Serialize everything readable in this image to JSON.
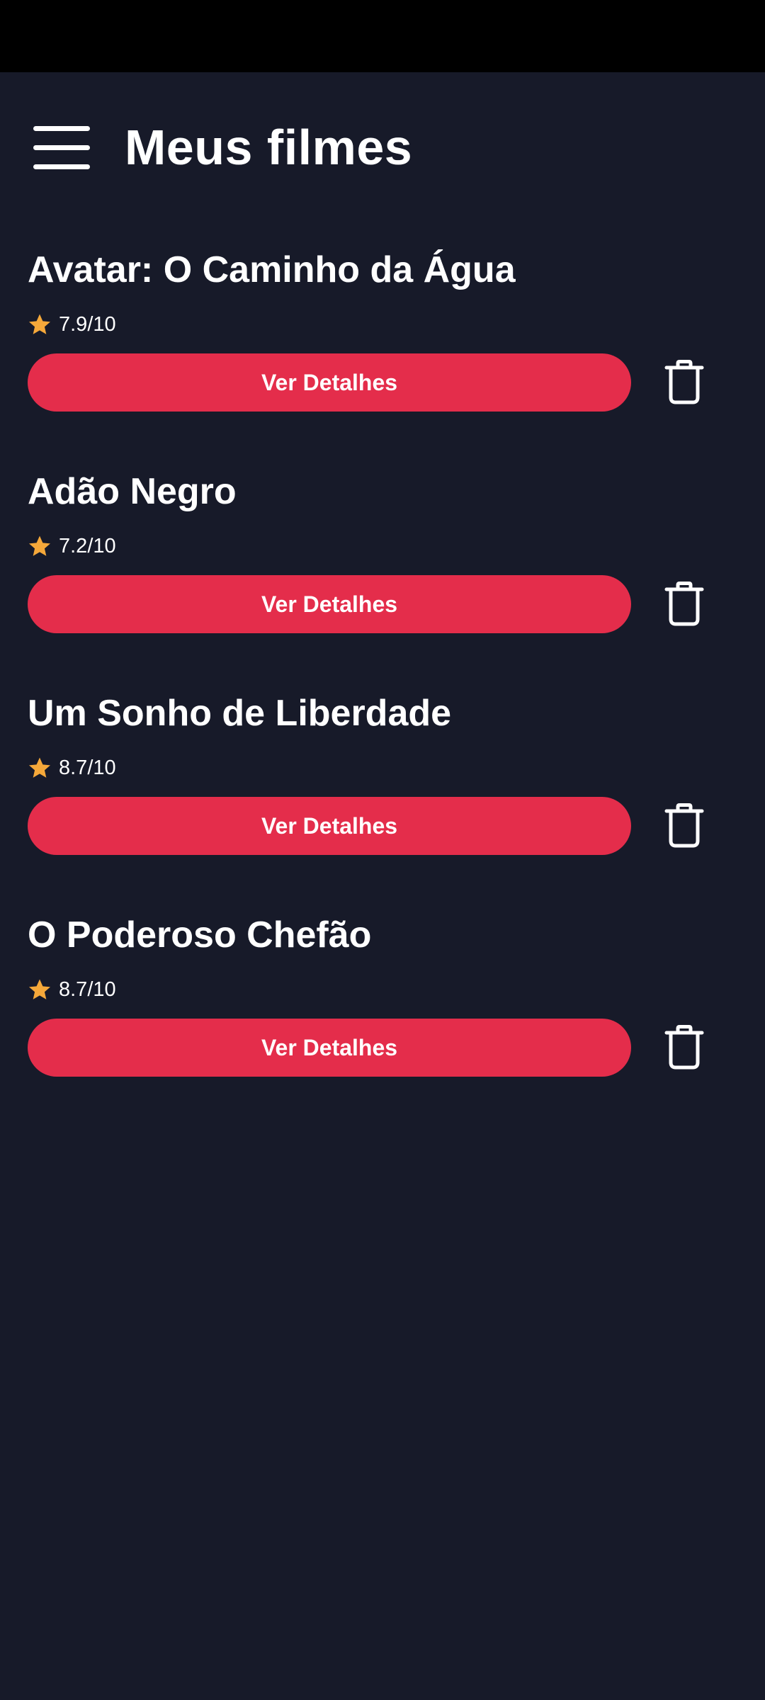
{
  "header": {
    "title": "Meus filmes",
    "menu_icon": "hamburger-menu-icon"
  },
  "colors": {
    "background": "#171a29",
    "status_bar": "#000000",
    "accent": "#e42d4b",
    "star": "#f5a83a",
    "text": "#ffffff"
  },
  "movies": [
    {
      "title": "Avatar: O Caminho da Água",
      "rating": "7.9/10",
      "details_label": "Ver Detalhes",
      "delete_icon": "trash-icon"
    },
    {
      "title": "Adão Negro",
      "rating": "7.2/10",
      "details_label": "Ver Detalhes",
      "delete_icon": "trash-icon"
    },
    {
      "title": "Um Sonho de Liberdade",
      "rating": "8.7/10",
      "details_label": "Ver Detalhes",
      "delete_icon": "trash-icon"
    },
    {
      "title": "O Poderoso Chefão",
      "rating": "8.7/10",
      "details_label": "Ver Detalhes",
      "delete_icon": "trash-icon"
    }
  ]
}
